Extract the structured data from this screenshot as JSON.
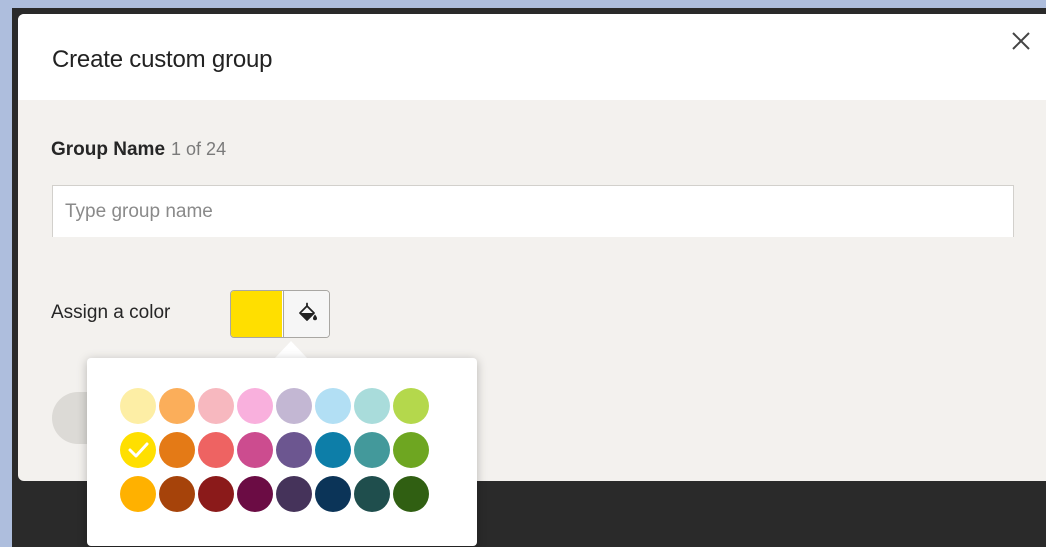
{
  "dialog": {
    "title": "Create custom group",
    "close_icon": "close-icon"
  },
  "group_name": {
    "label": "Group Name",
    "count": "1 of 24",
    "placeholder": "Type group name",
    "value": ""
  },
  "color": {
    "label": "Assign a color",
    "selected": "#ffdf00",
    "picker_icon": "paint-bucket-icon"
  },
  "palette": {
    "rows": [
      [
        "#fdeea5",
        "#fbae5a",
        "#f7b8bf",
        "#f9b0dd",
        "#c3b7d3",
        "#b2dff4",
        "#a9dcdb",
        "#b4d84c"
      ],
      [
        "#ffdf00",
        "#e47a16",
        "#ee6362",
        "#cc4c8f",
        "#6c5690",
        "#0d7ea8",
        "#43999b",
        "#6ea621"
      ],
      [
        "#ffb100",
        "#a6430a",
        "#8b1a1a",
        "#6b0c44",
        "#45335a",
        "#0b3458",
        "#1f4e4d",
        "#305f12"
      ]
    ],
    "selected_row": 1,
    "selected_col": 0
  }
}
